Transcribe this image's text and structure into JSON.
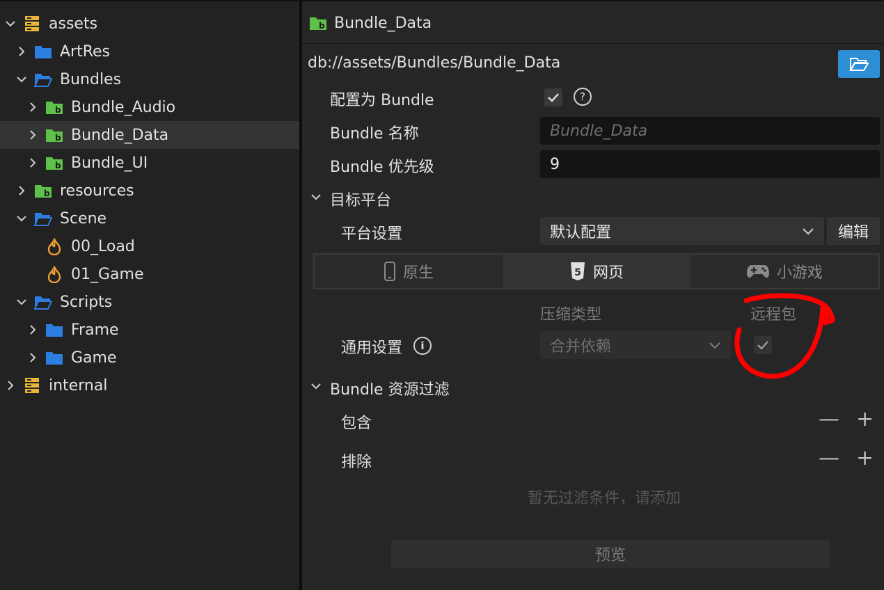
{
  "tree": {
    "items": [
      {
        "label": "assets",
        "icon": "database-icon",
        "expanded": true
      },
      {
        "label": "ArtRes",
        "icon": "folder-icon",
        "expanded": false
      },
      {
        "label": "Bundles",
        "icon": "folder-open-icon",
        "expanded": true
      },
      {
        "label": "Bundle_Audio",
        "icon": "bundle-folder-icon",
        "expanded": false
      },
      {
        "label": "Bundle_Data",
        "icon": "bundle-folder-icon",
        "expanded": false,
        "selected": true
      },
      {
        "label": "Bundle_UI",
        "icon": "bundle-folder-icon",
        "expanded": false
      },
      {
        "label": "resources",
        "icon": "bundle-folder-icon",
        "expanded": false
      },
      {
        "label": "Scene",
        "icon": "folder-open-icon",
        "expanded": true
      },
      {
        "label": "00_Load",
        "icon": "scene-flame-icon"
      },
      {
        "label": "01_Game",
        "icon": "scene-flame-icon"
      },
      {
        "label": "Scripts",
        "icon": "folder-open-icon",
        "expanded": true
      },
      {
        "label": "Frame",
        "icon": "folder-icon",
        "expanded": false
      },
      {
        "label": "Game",
        "icon": "folder-icon",
        "expanded": false
      },
      {
        "label": "internal",
        "icon": "database-icon",
        "expanded": false
      }
    ]
  },
  "inspector": {
    "title": "Bundle_Data",
    "path": "db://assets/Bundles/Bundle_Data",
    "config_as_bundle_label": "配置为 Bundle",
    "config_as_bundle_checked": true,
    "bundle_name_label": "Bundle 名称",
    "bundle_name_placeholder": "Bundle_Data",
    "bundle_priority_label": "Bundle 优先级",
    "bundle_priority_value": "9",
    "target_platform_label": "目标平台",
    "platform_settings_label": "平台设置",
    "platform_settings_value": "默认配置",
    "edit_button": "编辑",
    "tabs": [
      {
        "label": "原生",
        "icon": "phone-icon",
        "active": false
      },
      {
        "label": "网页",
        "icon": "html5-icon",
        "active": true
      },
      {
        "label": "小游戏",
        "icon": "gamepad-icon",
        "active": false
      }
    ],
    "compression_type_header": "压缩类型",
    "remote_bundle_header": "远程包",
    "general_settings_label": "通用设置",
    "compression_value": "合并依赖",
    "remote_checked": true,
    "filter_section_label": "Bundle 资源过滤",
    "include_label": "包含",
    "exclude_label": "排除",
    "minus_glyph": "—",
    "plus_glyph": "+",
    "empty_filter_text": "暂无过滤条件，请添加",
    "preview_button": "预览"
  },
  "colors": {
    "accent": "#2e8fd6",
    "annotation": "#ff0000",
    "bundle_green": "#5ec14b",
    "folder_blue": "#2c7fe0",
    "database_yellow": "#e8b53a",
    "scene_orange": "#f0a034"
  }
}
